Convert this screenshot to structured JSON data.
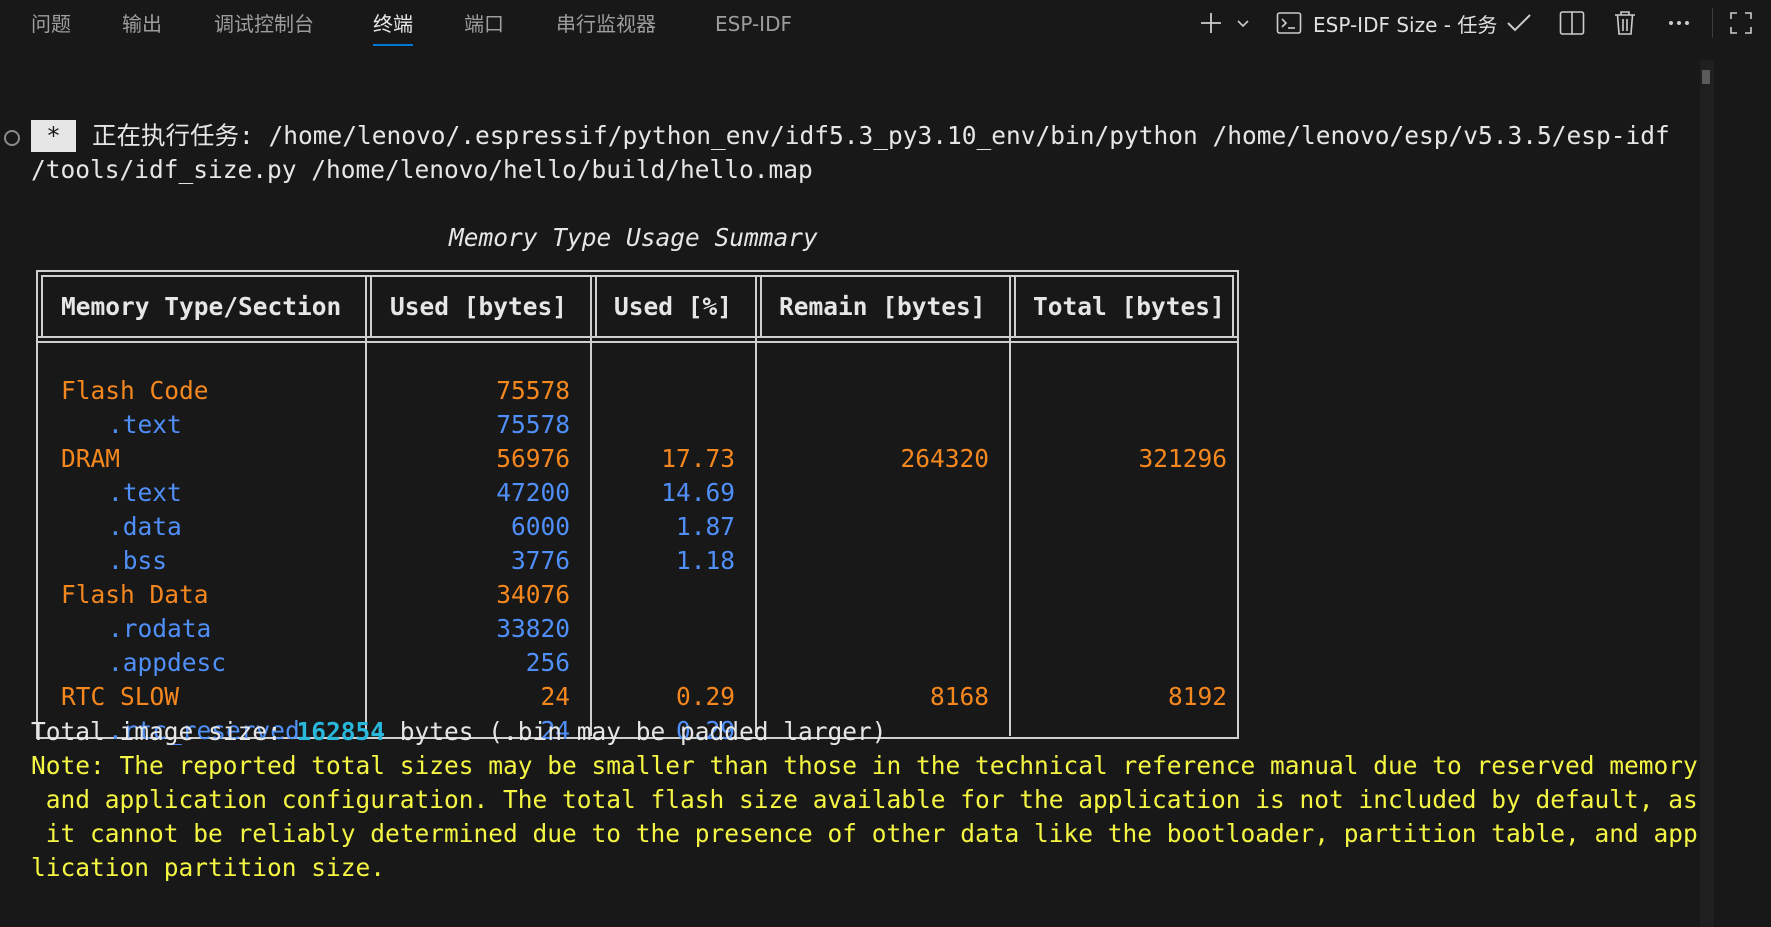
{
  "panel": {
    "tabs": [
      {
        "label": "问题"
      },
      {
        "label": "输出"
      },
      {
        "label": "调试控制台"
      },
      {
        "label": "终端"
      },
      {
        "label": "端口"
      },
      {
        "label": "串行监视器"
      },
      {
        "label": "ESP-IDF"
      }
    ],
    "active_tab": "终端",
    "task_name": "ESP-IDF Size - 任务",
    "icons": [
      "plus-icon",
      "chevron-down-icon",
      "terminal-icon",
      "check-icon",
      "split-icon",
      "trash-icon",
      "more-icon",
      "maximize-icon"
    ]
  },
  "terminal": {
    "star": "*",
    "task_line_1": "正在执行任务: /home/lenovo/.espressif/python_env/idf5.3_py3.10_env/bin/python /home/lenovo/esp/v5.3.5/esp-idf",
    "task_line_2": "/tools/idf_size.py /home/lenovo/hello/build/hello.map",
    "table_title": "Memory Type Usage Summary",
    "headers": [
      "Memory Type/Section",
      "Used [bytes]",
      "Used [%]",
      "Remain [bytes]",
      "Total [bytes]"
    ],
    "rows": [
      {
        "name": "Flash Code",
        "used": "75578",
        "pct": "",
        "remain": "",
        "total": "",
        "level": "type"
      },
      {
        "name": ".text",
        "used": "75578",
        "pct": "",
        "remain": "",
        "total": "",
        "level": "section"
      },
      {
        "name": "DRAM",
        "used": "56976",
        "pct": "17.73",
        "remain": "264320",
        "total": "321296",
        "level": "type"
      },
      {
        "name": ".text",
        "used": "47200",
        "pct": "14.69",
        "remain": "",
        "total": "",
        "level": "section"
      },
      {
        "name": ".data",
        "used": "6000",
        "pct": "1.87",
        "remain": "",
        "total": "",
        "level": "section"
      },
      {
        "name": ".bss",
        "used": "3776",
        "pct": "1.18",
        "remain": "",
        "total": "",
        "level": "section"
      },
      {
        "name": "Flash Data",
        "used": "34076",
        "pct": "",
        "remain": "",
        "total": "",
        "level": "type"
      },
      {
        "name": ".rodata",
        "used": "33820",
        "pct": "",
        "remain": "",
        "total": "",
        "level": "section"
      },
      {
        "name": ".appdesc",
        "used": "256",
        "pct": "",
        "remain": "",
        "total": "",
        "level": "section"
      },
      {
        "name": "RTC SLOW",
        "used": "24",
        "pct": "0.29",
        "remain": "8168",
        "total": "8192",
        "level": "type"
      },
      {
        "name": ".rtc_reserved",
        "used": "24",
        "pct": "0.29",
        "remain": "",
        "total": "",
        "level": "section"
      }
    ],
    "total_prefix": "Total image size: ",
    "total_value": "162854",
    "total_suffix": " bytes (.bin may be padded larger)",
    "note_lines": [
      "Note: The reported total sizes may be smaller than those in the technical reference manual due to reserved memory",
      " and application configuration. The total flash size available for the application is not included by default, as",
      " it cannot be reliably determined due to the presence of other data like the bootloader, partition table, and app",
      "lication partition size."
    ]
  },
  "colors": {
    "background": "#181818",
    "type_row": "#f5871f",
    "section_row": "#4f8ff7",
    "highlight": "#29b8db",
    "note": "#f5f543",
    "accent": "#0078d4"
  }
}
